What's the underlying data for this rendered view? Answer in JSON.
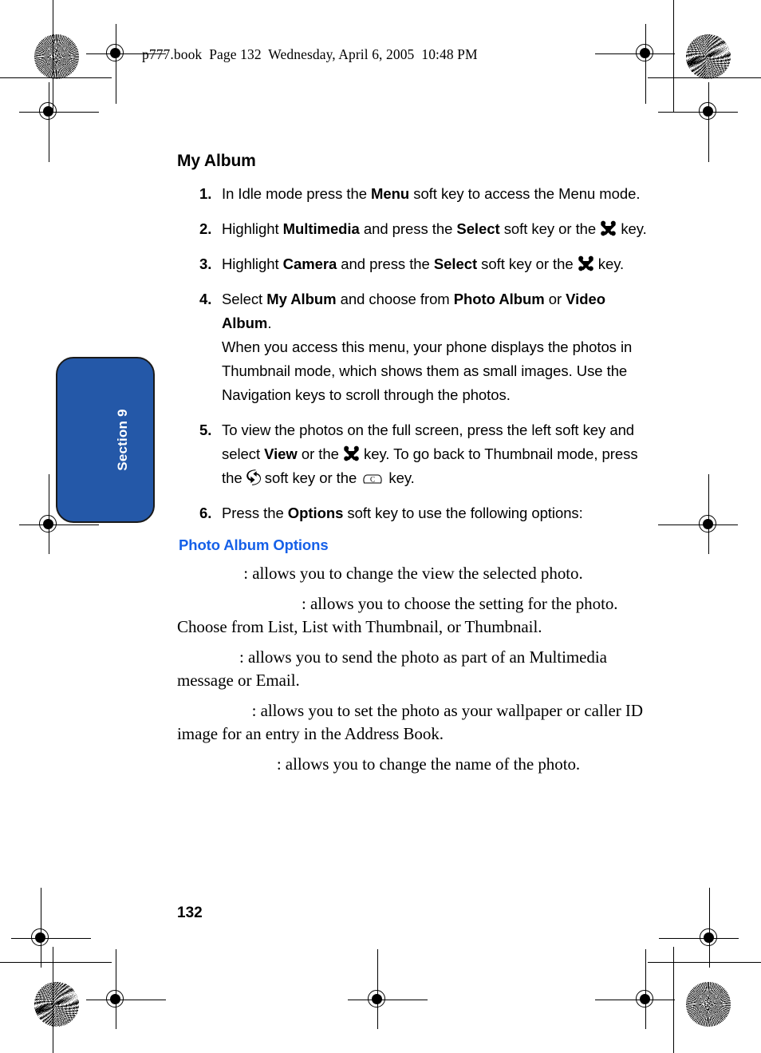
{
  "running_header": "p777.book  Page 132  Wednesday, April 6, 2005  10:48 PM",
  "side_tab": {
    "label": "Section 9",
    "color": "#2458a8"
  },
  "page_number": "132",
  "main": {
    "title": "My Album",
    "steps": [
      {
        "num": "1.",
        "parts": [
          {
            "t": "In Idle mode press the ",
            "bold": false
          },
          {
            "t": "Menu",
            "bold": true
          },
          {
            "t": " soft key to access the Menu mode.",
            "bold": false
          }
        ]
      },
      {
        "num": "2.",
        "parts": [
          {
            "t": "Highlight ",
            "bold": false
          },
          {
            "t": "Multimedia",
            "bold": true
          },
          {
            "t": " and press the ",
            "bold": false
          },
          {
            "t": "Select",
            "bold": true
          },
          {
            "t": " soft key or the ",
            "bold": false
          },
          {
            "icon": "nav-ok-key-icon"
          },
          {
            "t": " key.",
            "bold": false
          }
        ]
      },
      {
        "num": "3.",
        "parts": [
          {
            "t": "Highlight ",
            "bold": false
          },
          {
            "t": "Camera",
            "bold": true
          },
          {
            "t": " and press the ",
            "bold": false
          },
          {
            "t": "Select",
            "bold": true
          },
          {
            "t": " soft key or the ",
            "bold": false
          },
          {
            "icon": "nav-ok-key-icon"
          },
          {
            "t": " key.",
            "bold": false
          }
        ]
      },
      {
        "num": "4.",
        "parts": [
          {
            "t": "Select ",
            "bold": false
          },
          {
            "t": "My Album",
            "bold": true
          },
          {
            "t": " and choose from ",
            "bold": false
          },
          {
            "t": "Photo Album",
            "bold": true
          },
          {
            "t": " or ",
            "bold": false
          },
          {
            "t": "Video Album",
            "bold": true
          },
          {
            "t": ".",
            "bold": false
          }
        ],
        "extra": "When you access this menu, your phone displays the photos in Thumbnail mode, which shows them as small images. Use the Navigation keys to scroll through the photos."
      },
      {
        "num": "5.",
        "parts": [
          {
            "t": "To view the photos on the full screen, press the left soft key and select ",
            "bold": false
          },
          {
            "t": "View",
            "bold": true
          },
          {
            "t": " or the ",
            "bold": false
          },
          {
            "icon": "nav-ok-key-icon"
          },
          {
            "t": " key. To go back to Thumbnail mode, press the ",
            "bold": false
          },
          {
            "icon": "back-arrow-key-icon"
          },
          {
            "t": " soft key or the ",
            "bold": false
          },
          {
            "icon": "clear-c-key-icon"
          },
          {
            "t": " key.",
            "bold": false
          }
        ]
      },
      {
        "num": "6.",
        "parts": [
          {
            "t": "Press the ",
            "bold": false
          },
          {
            "t": "Options",
            "bold": true
          },
          {
            "t": " soft key to use the following options:",
            "bold": false
          }
        ]
      }
    ],
    "options_heading": "Photo Album Options",
    "options": [
      {
        "indent": "                ",
        "text": ": allows you to change the view the selected photo."
      },
      {
        "indent": "                              ",
        "text": ": allows you to choose the setting for the photo. Choose from List, List with Thumbnail, or Thumbnail."
      },
      {
        "indent": "               ",
        "text": ": allows you to send the photo as part of an Multimedia message or Email."
      },
      {
        "indent": "                  ",
        "text": ": allows you to set the photo as your wallpaper or caller ID image for an entry in the Address Book."
      },
      {
        "indent": "                        ",
        "text": ": allows you to change the name of the photo."
      }
    ]
  }
}
